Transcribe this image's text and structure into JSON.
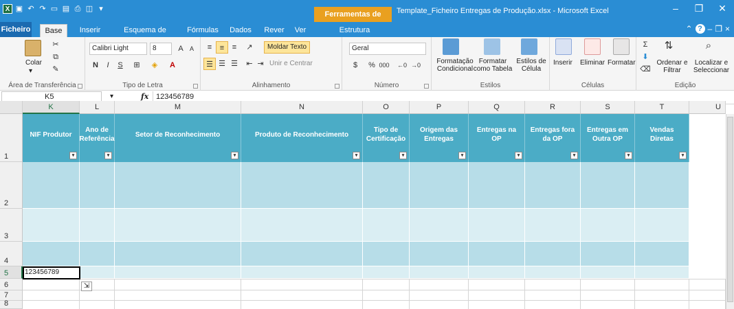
{
  "window": {
    "title": "Template_Ficheiro Entregas de Produção.xlsx - Microsoft Excel",
    "context_tab": "Ferramentas de Tabela"
  },
  "ribbon_tabs": [
    {
      "label": "Ficheiro"
    },
    {
      "label": "Base"
    },
    {
      "label": "Inserir"
    },
    {
      "label": "Esquema de Página"
    },
    {
      "label": "Fórmulas"
    },
    {
      "label": "Dados"
    },
    {
      "label": "Rever"
    },
    {
      "label": "Ver"
    },
    {
      "label": "Estrutura"
    }
  ],
  "ribbon": {
    "clipboard": {
      "paste": "Colar",
      "label": "Área de Transferência"
    },
    "font": {
      "name": "Calibri Light",
      "size": "8",
      "label": "Tipo de Letra",
      "bold": "N",
      "italic": "I",
      "underline": "S"
    },
    "alignment": {
      "wrap": "Moldar Texto",
      "merge": "Unir e Centrar",
      "label": "Alinhamento"
    },
    "number": {
      "format": "Geral",
      "percent": "%",
      "thousands": "000",
      "label": "Número"
    },
    "styles": {
      "conditional": "Formatação Condicional",
      "as_table": "Formatar como Tabela",
      "cell_styles": "Estilos de Célula",
      "label": "Estilos"
    },
    "cells": {
      "insert": "Inserir",
      "delete": "Eliminar",
      "format": "Formatar",
      "label": "Células"
    },
    "editing": {
      "sort": "Ordenar e Filtrar",
      "find": "Localizar e Seleccionar",
      "label": "Edição"
    }
  },
  "formula_bar": {
    "name_box": "K5",
    "fx": "fx",
    "content": "123456789"
  },
  "columns": [
    "K",
    "L",
    "M",
    "N",
    "O",
    "P",
    "Q",
    "R",
    "S",
    "T",
    "U"
  ],
  "rows": [
    "1",
    "2",
    "3",
    "4",
    "5",
    "6",
    "7",
    "8"
  ],
  "table_headers": [
    "NIF Produtor",
    "Ano de Referência",
    "Setor de Reconhecimento",
    "Produto de Reconhecimento",
    "Tipo de Certificação",
    "Origem das Entregas",
    "Entregas na OP",
    "Entregas fora da OP",
    "Entregas em Outra OP",
    "Vendas Diretas"
  ],
  "active_cell": {
    "ref": "K5",
    "value": "123456789"
  },
  "colors": {
    "header": "#4bacc6",
    "band_dark": "#b7dde8",
    "band_light": "#daeef3",
    "title_bar": "#2a8dd4",
    "context": "#e9a020"
  }
}
